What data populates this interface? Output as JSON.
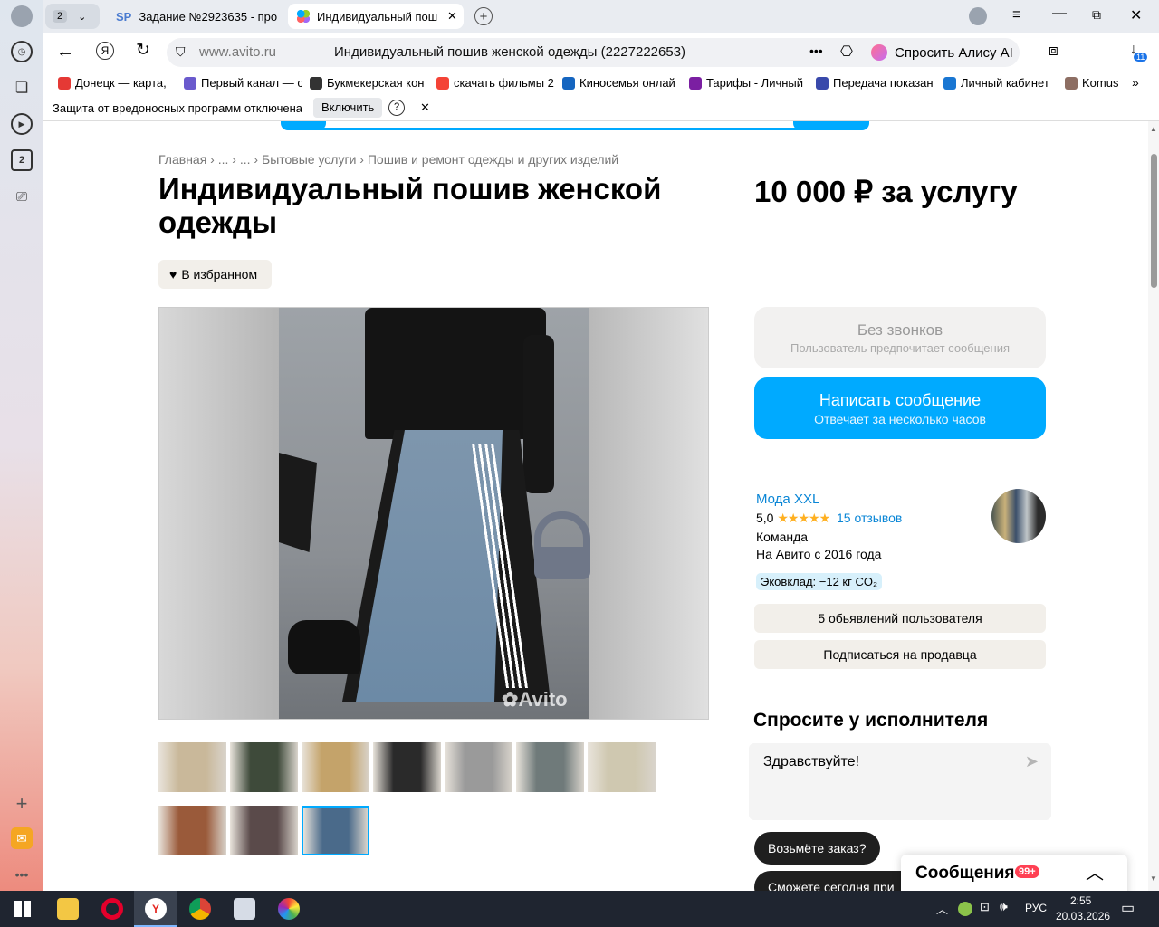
{
  "browser": {
    "tab_count": "2",
    "tabs": [
      {
        "icon_label": "SP",
        "title": "Задание №2923635 - про"
      },
      {
        "title": "Индивидуальный пош"
      }
    ],
    "url": "www.avito.ru",
    "page_title": "Индивидуальный пошив женской одежды (2227222653)",
    "alice_label": "Спросить Алису AI",
    "downloads_badge": "11",
    "bookmarks": [
      {
        "label": "Донецк — карта,",
        "color": "#e53935"
      },
      {
        "label": "Первый канал — с",
        "color": "#6a5acd"
      },
      {
        "label": "Букмекерская кон",
        "color": "#333333"
      },
      {
        "label": "скачать фильмы 2",
        "color": "#f44336"
      },
      {
        "label": "Киносемья онлай",
        "color": "#1565c0"
      },
      {
        "label": "Тарифы - Личный",
        "color": "#7b1fa2"
      },
      {
        "label": "Передача показан",
        "color": "#3949ab"
      },
      {
        "label": "Личный кабинет",
        "color": "#1976d2"
      },
      {
        "label": "Komus",
        "color": "#8d6e63"
      }
    ],
    "security_msg": "Защита от вредоносных программ отключена",
    "security_btn": "Включить",
    "security_help": "?",
    "sidebar_badge": "2"
  },
  "page": {
    "breadcrumbs": [
      "Главная",
      "...",
      "...",
      "Бытовые услуги",
      "Пошив и ремонт одежды и других изделий"
    ],
    "title": "Индивидуальный пошив женской одежды",
    "favorite": "В избранном",
    "price": "10 000 ₽ за услугу",
    "watermark": "Avito",
    "no_calls_title": "Без звонков",
    "no_calls_sub": "Пользователь предпочитает сообщения",
    "write_title": "Написать сообщение",
    "write_sub": "Отвечает за несколько часов",
    "seller": {
      "name": "Мода XXL",
      "rating": "5,0",
      "stars": "★★★★★",
      "reviews": "15 отзывов",
      "type": "Команда",
      "since": "На Авито с 2016 года",
      "eco": "Эковклад: −12 кг CO₂"
    },
    "ads_btn": "5 обьявлений пользователя",
    "subscribe_btn": "Подписаться на продавца",
    "ask_title": "Спросите у исполнителя",
    "ask_text": "Здравствуйте!",
    "quick_questions": [
      "Возьмёте заказ?",
      "Сможете сегодня при"
    ],
    "messages_label": "Сообщения",
    "messages_badge": "99+",
    "thumbs_colors": [
      "#c9b89a",
      "#3e4a3a",
      "#c4a36a",
      "#2a2a2a",
      "#9a9a9a",
      "#6f7a7a",
      "#cfc8b0",
      "#9a5a3a",
      "#5a4a4a",
      "#4a6a8a"
    ]
  },
  "taskbar": {
    "lang": "РУС",
    "time": "2:55",
    "date": "20.03.2026"
  }
}
